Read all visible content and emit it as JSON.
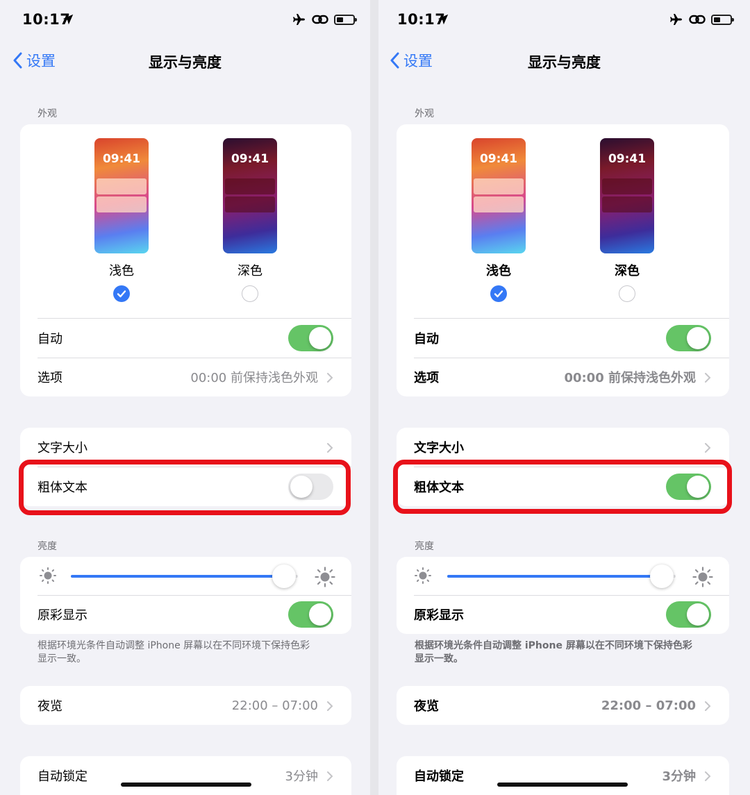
{
  "status_bar": {
    "time": "10:17"
  },
  "nav": {
    "back_label": "设置",
    "title": "显示与亮度"
  },
  "appearance": {
    "section_label": "外观",
    "preview_time": "09:41",
    "light_label": "浅色",
    "dark_label": "深色",
    "selected": "浅色"
  },
  "auto_row": {
    "label": "自动",
    "on": true
  },
  "options_row": {
    "label": "选项",
    "value": "00:00 前保持浅色外观"
  },
  "text_size_row": {
    "label": "文字大小"
  },
  "bold_text_row": {
    "label": "粗体文本"
  },
  "brightness": {
    "section_label": "亮度",
    "level": 0.94
  },
  "true_tone_row": {
    "label": "原彩显示",
    "on": true
  },
  "true_tone_footnote": "根据环境光条件自动调整 iPhone 屏幕以在不同环境下保持色彩显示一致。",
  "night_shift_row": {
    "label": "夜览",
    "value": "22:00 – 07:00"
  },
  "auto_lock_row": {
    "label": "自动锁定",
    "value": "3分钟"
  },
  "comparison": {
    "left_bold_text_on": false,
    "right_bold_text_on": true
  },
  "colors": {
    "accent": "#3478f6",
    "toggle_on": "#65c466",
    "highlight": "#e8111a",
    "background": "#f2f2f7"
  }
}
